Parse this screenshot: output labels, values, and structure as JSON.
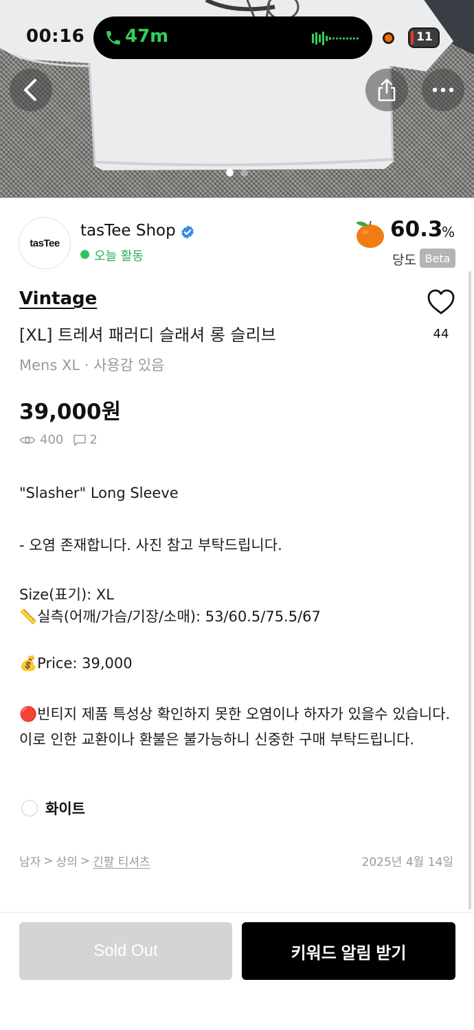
{
  "status_bar": {
    "time": "00:16",
    "call_duration": "47m",
    "battery_level": "11"
  },
  "gallery": {
    "image_count": 2,
    "active_index": 0
  },
  "icons": {
    "back": "chevron-left-icon",
    "share": "share-icon",
    "more": "more-icon",
    "like": "heart-icon",
    "views": "eye-icon",
    "comments": "chat-icon",
    "sweetness": "tangerine-icon",
    "verified": "verified-badge-icon"
  },
  "shop": {
    "logo_text": "tasTee",
    "name": "tasTee Shop",
    "activity": "오늘 활동"
  },
  "sweetness": {
    "value": "60.3",
    "unit": "%",
    "label": "당도",
    "badge": "Beta"
  },
  "product": {
    "brand": "Vintage",
    "title": "[XL] 트레셔 패러디 슬래셔 롱 슬리브",
    "meta": "Mens XL · 사용감 있음",
    "price": "39,000원",
    "like_count": "44",
    "views": "400",
    "comments": "2"
  },
  "description": {
    "line1": "\"Slasher\" Long Sleeve",
    "line2": "- 오염 존재합니다. 사진 참고 부탁드립니다.",
    "line3": "Size(표기): XL",
    "line4": "📏실측(어깨/가슴/기장/소매): 53/60.5/75.5/67",
    "line5": "💰Price: 39,000",
    "line6": "🔴빈티지 제품 특성상 확인하지 못한 오염이나 하자가 있을수 있습니다. 이로 인한 교환이나 환불은 불가능하니 신중한 구매 부탁드립니다."
  },
  "option": {
    "color": "화이트"
  },
  "category": {
    "level1": "남자",
    "level2": "상의",
    "level3": "긴팔 티셔츠",
    "separator": ">"
  },
  "posted_date": "2025년 4월 14일",
  "actions": {
    "sold_out": "Sold Out",
    "keyword_alert": "키워드 알림 받기"
  },
  "colors": {
    "accent_green": "#2ec45a",
    "primary_button": "#000000",
    "disabled_button": "#d4d4d4",
    "verified_blue": "#3b8be8"
  }
}
